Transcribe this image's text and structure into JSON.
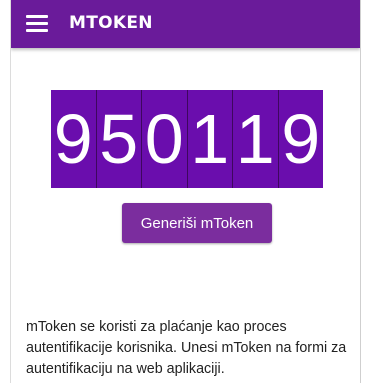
{
  "app_bar": {
    "title": "MTOKEN",
    "menu_icon": "hamburger-menu-icon",
    "background": "#6a1b9a"
  },
  "token": {
    "digits": [
      "9",
      "5",
      "0",
      "1",
      "1",
      "9"
    ],
    "cell_color": "#6a0dad"
  },
  "generate_button": {
    "label": "Generiši mToken",
    "color": "#7b2d9e"
  },
  "description": {
    "text": "mToken se koristi za plaćanje kao proces autentifikacije korisnika. Unesi mToken na formi za autentifikaciju na web aplikaciji."
  }
}
